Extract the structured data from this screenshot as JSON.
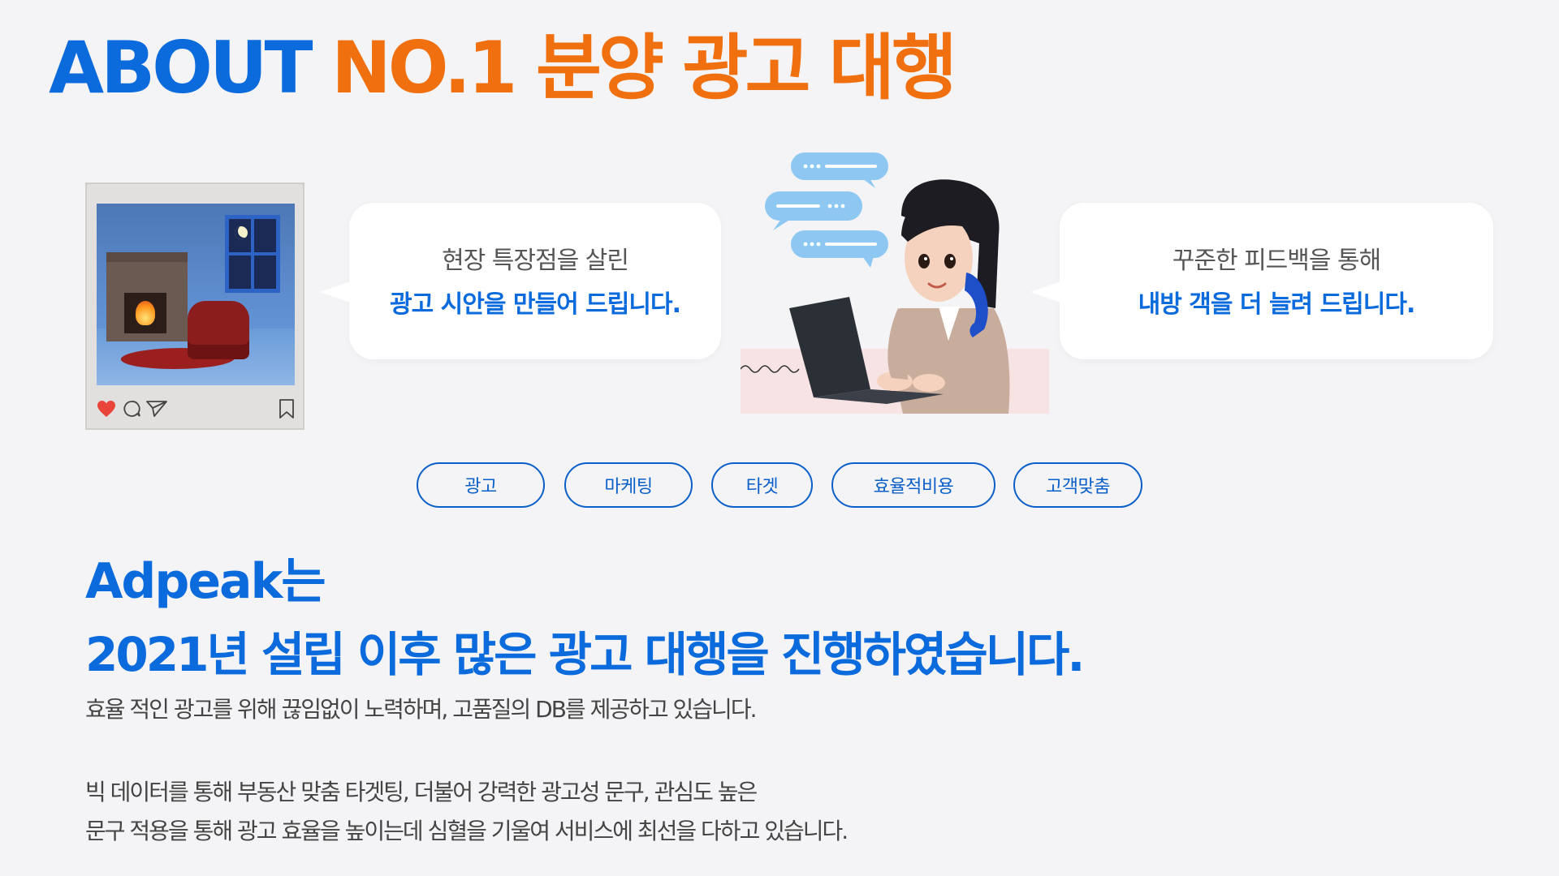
{
  "hero": {
    "title_blue": "ABOUT",
    "title_orange": "NO.1 분양 광고 대행"
  },
  "bubbles": {
    "left": {
      "line1": "현장 특장점을 살린",
      "line2": "광고 시안을 만들어 드립니다."
    },
    "right": {
      "line1": "꾸준한 피드백을 통해",
      "line2": "내방 객을 더 늘려 드립니다."
    }
  },
  "tags": [
    "광고",
    "마케팅",
    "타겟",
    "효율적비용",
    "고객맞춤"
  ],
  "about": {
    "name": "Adpeak는",
    "headline": "2021년 설립 이후 많은 광고 대행을 진행하였습니다.",
    "paragraphs": [
      "효율 적인 광고를 위해 끊임없이 노력하며,  고품질의 DB를 제공하고 있습니다.",
      "빅 데이터를 통해 부동산 맞춤 타겟팅, 더불어 강력한 광고성 문구, 관심도 높은",
      "문구 적용을 통해 광고 효율을 높이는데 심혈을 기울여  서비스에 최선을 다하고 있습니다."
    ]
  },
  "colors": {
    "primary_blue": "#0b6bdc",
    "accent_orange": "#f07010",
    "background": "#f4f4f6"
  },
  "icons": [
    "heart-icon",
    "comment-icon",
    "send-icon",
    "bookmark-icon",
    "chat-bubble-icon"
  ]
}
